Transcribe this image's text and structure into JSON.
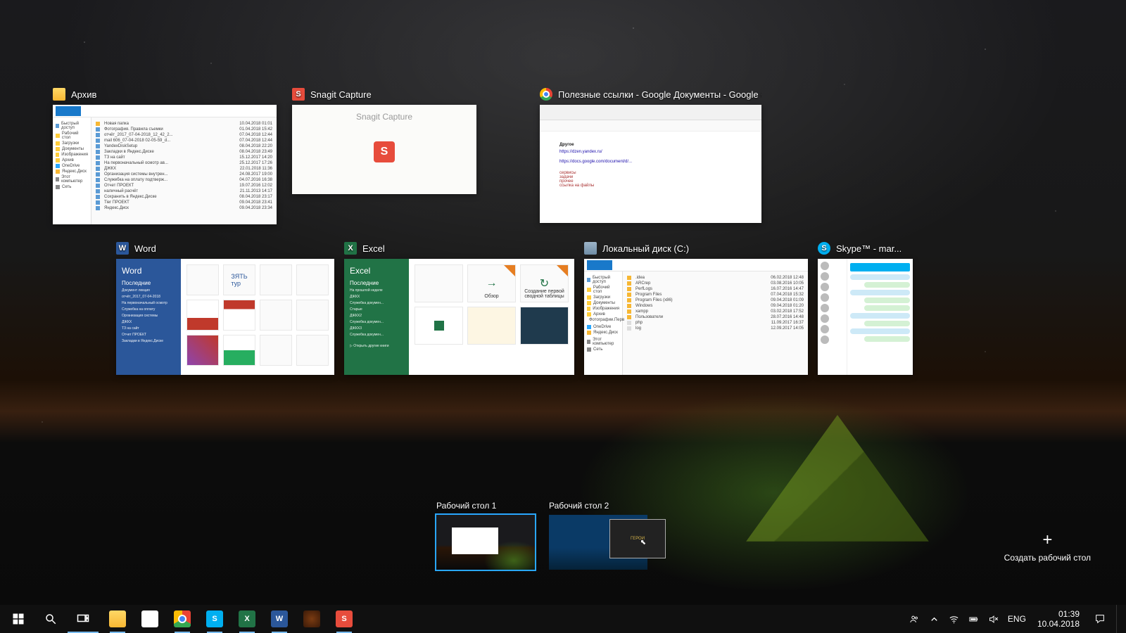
{
  "windows": {
    "archive": {
      "title": "Архив"
    },
    "snagit": {
      "title": "Snagit Capture",
      "thumb_text": "Snagit Capture"
    },
    "chrome": {
      "title": "Полезные ссылки - Google Документы - Google C...",
      "doc_heading": "Другое"
    },
    "word": {
      "title": "Word",
      "side_title": "Word",
      "side_section": "Последние"
    },
    "excel": {
      "title": "Excel",
      "side_title": "Excel",
      "side_section": "Последние",
      "tiles": [
        "Обзор",
        "Создание первой сводной таблицы"
      ]
    },
    "cdrive": {
      "title": "Локальный диск (C:)"
    },
    "skype": {
      "title": "Skype™ - mar..."
    }
  },
  "desktops": {
    "one": {
      "label": "Рабочий стол 1"
    },
    "two": {
      "label": "Рабочий стол 2",
      "game_label": "ГЕРОИ"
    },
    "new": {
      "label": "Создать рабочий стол"
    }
  },
  "tray": {
    "lang": "ENG",
    "time": "01:39",
    "date": "10.04.2018"
  },
  "icons": {
    "word": "W",
    "excel": "X",
    "skype": "S",
    "snagit": "S",
    "store": "⊞"
  }
}
